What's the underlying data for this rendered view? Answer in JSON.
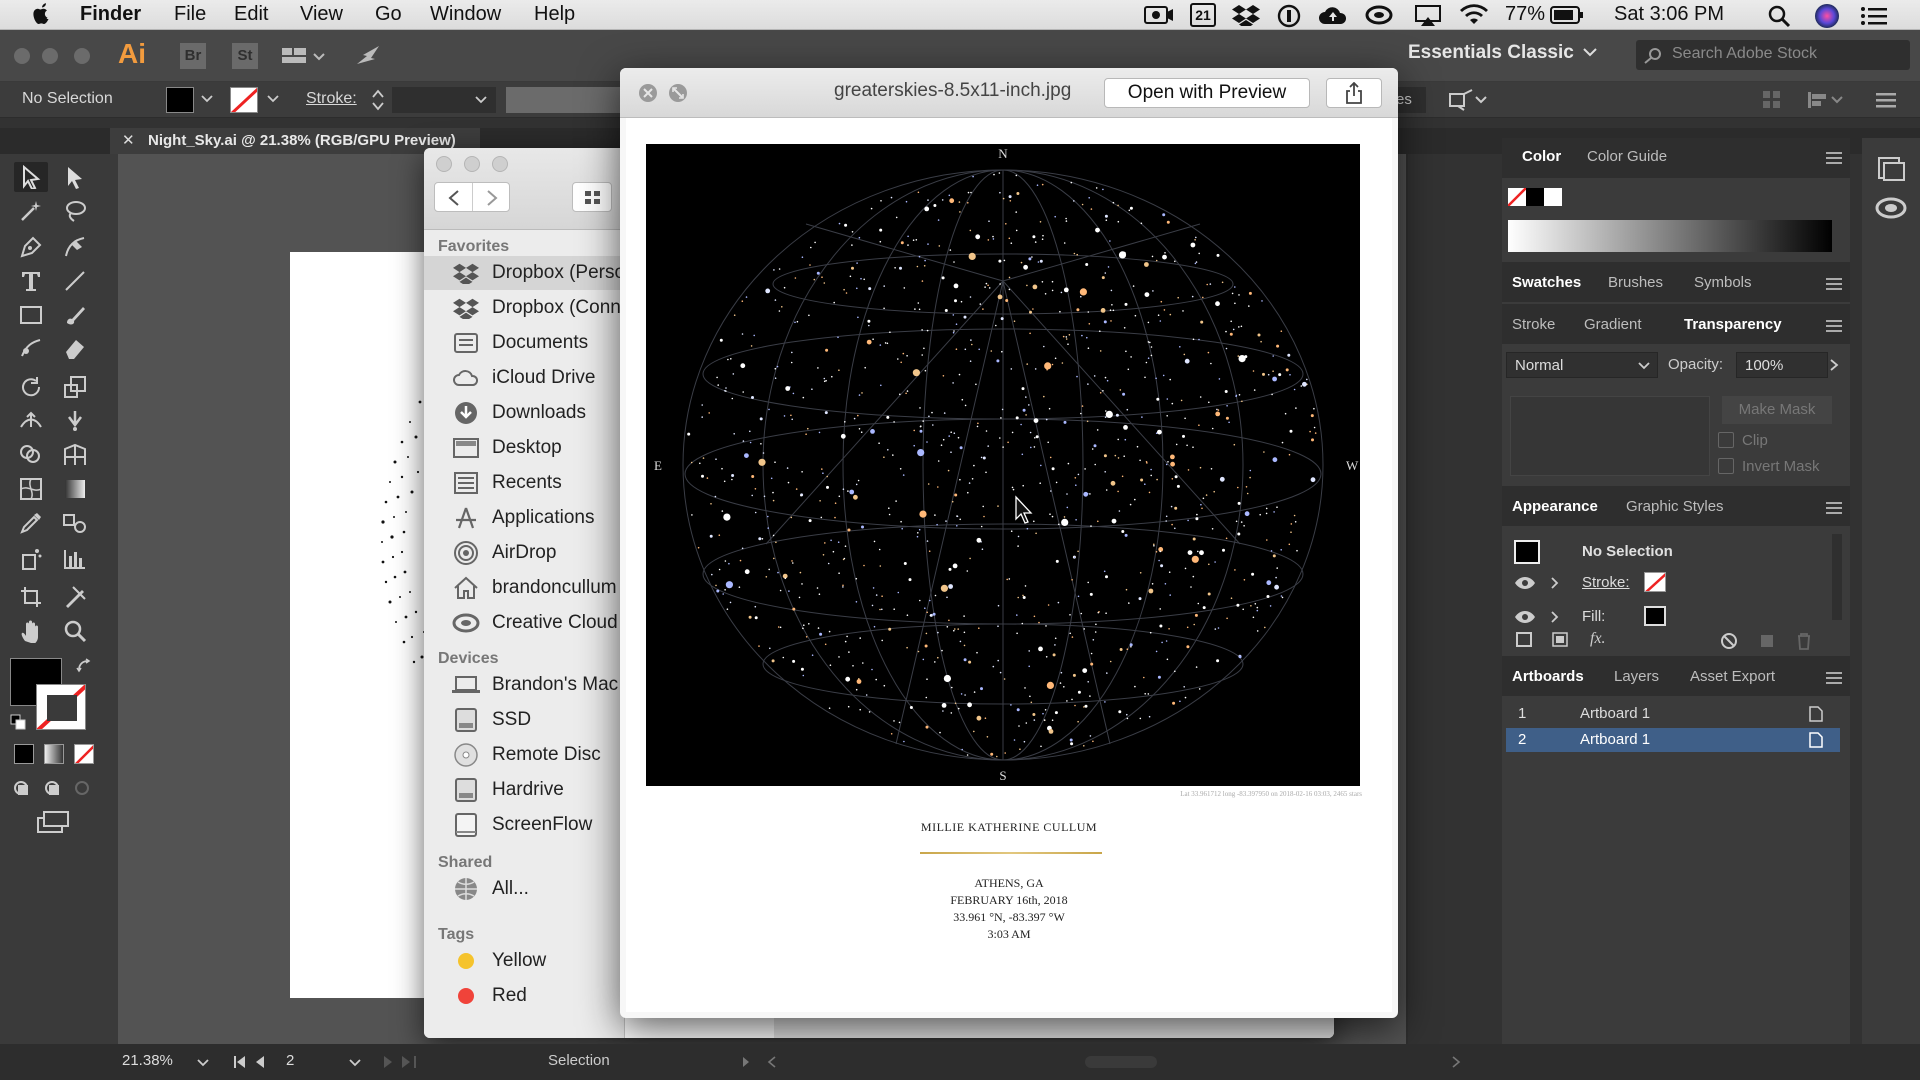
{
  "menubar": {
    "app": "Finder",
    "items": [
      "File",
      "Edit",
      "View",
      "Go",
      "Window",
      "Help"
    ],
    "calendar_day": "21",
    "battery": "77%",
    "clock": "Sat 3:06 PM"
  },
  "illustrator": {
    "logo": "Ai",
    "bridge": "Br",
    "stock": "St",
    "workspace": "Essentials Classic",
    "search_placeholder": "Search Adobe Stock",
    "control": {
      "selection": "No Selection",
      "stroke_label": "Stroke:",
      "partial_label": "es"
    },
    "doc_tab": "Night_Sky.ai @ 21.38% (RGB/GPU Preview)",
    "status": {
      "zoom": "21.38%",
      "artboard_num": "2",
      "tool": "Selection"
    }
  },
  "panels": {
    "color_tabs": [
      "Color",
      "Color Guide"
    ],
    "swatch_tabs": [
      "Swatches",
      "Brushes",
      "Symbols"
    ],
    "transparency_tabs": [
      "Stroke",
      "Gradient",
      "Transparency"
    ],
    "blend_mode": "Normal",
    "opacity_label": "Opacity:",
    "opacity_value": "100%",
    "make_mask": "Make Mask",
    "clip": "Clip",
    "invert_mask": "Invert Mask",
    "appearance_tabs": [
      "Appearance",
      "Graphic Styles"
    ],
    "appearance_selection": "No Selection",
    "stroke_label": "Stroke:",
    "fill_label": "Fill:",
    "fx_label": "fx.",
    "artboard_tabs": [
      "Artboards",
      "Layers",
      "Asset Export"
    ],
    "artboards": [
      {
        "num": "1",
        "name": "Artboard 1"
      },
      {
        "num": "2",
        "name": "Artboard 1"
      }
    ]
  },
  "finder": {
    "favorites_label": "Favorites",
    "favorites": [
      {
        "label": "Dropbox (Perso",
        "icon": "dropbox-icon"
      },
      {
        "label": "Dropbox (Conn",
        "icon": "dropbox-icon"
      },
      {
        "label": "Documents",
        "icon": "documents-icon"
      },
      {
        "label": "iCloud Drive",
        "icon": "cloud-icon"
      },
      {
        "label": "Downloads",
        "icon": "downloads-icon"
      },
      {
        "label": "Desktop",
        "icon": "desktop-icon"
      },
      {
        "label": "Recents",
        "icon": "recents-icon"
      },
      {
        "label": "Applications",
        "icon": "applications-icon"
      },
      {
        "label": "AirDrop",
        "icon": "airdrop-icon"
      },
      {
        "label": "brandoncullum",
        "icon": "home-icon"
      },
      {
        "label": "Creative Cloud",
        "icon": "creative-cloud-icon"
      }
    ],
    "devices_label": "Devices",
    "devices": [
      {
        "label": "Brandon's Mac",
        "icon": "laptop-icon"
      },
      {
        "label": "SSD",
        "icon": "disk-icon"
      },
      {
        "label": "Remote Disc",
        "icon": "disc-icon"
      },
      {
        "label": "Hardrive",
        "icon": "disk-icon"
      },
      {
        "label": "ScreenFlow",
        "icon": "volume-icon"
      }
    ],
    "shared_label": "Shared",
    "shared": [
      {
        "label": "All...",
        "icon": "network-icon"
      }
    ],
    "tags_label": "Tags",
    "tags": [
      {
        "label": "Yellow",
        "color": "#f5c32c"
      },
      {
        "label": "Red",
        "color": "#f0433a"
      }
    ]
  },
  "quicklook": {
    "filename": "greaterskies-8.5x11-inch.jpg",
    "open_button": "Open with Preview",
    "poster": {
      "north": "N",
      "south": "S",
      "east": "E",
      "west": "W",
      "caption": "Lat 33.961712 long -83.397950 on 2018-02-16 03:03, 2465 stars",
      "name": "MILLIE KATHERINE CULLUM",
      "city": "ATHENS, GA",
      "date": "FEBRUARY 16th, 2018",
      "coords": "33.961 °N, -83.397 °W",
      "time": "3:03 AM"
    }
  },
  "colors": {
    "accent": "#5b7fb4",
    "selected_row": "#3f5f88",
    "finder_sidebar": "#ececec",
    "ai_panel": "#3b3b3b"
  }
}
